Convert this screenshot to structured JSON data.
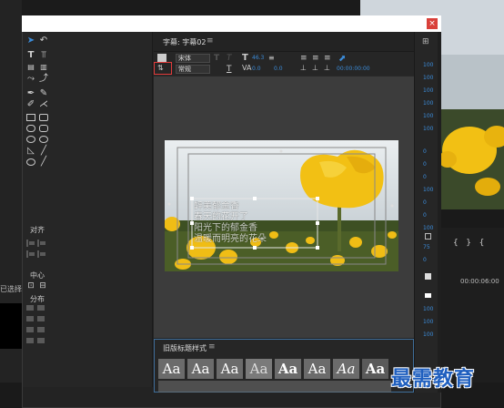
{
  "background": {
    "left_label": "已选择",
    "timecode": "00:00:06:00",
    "brackets": "{   }   {"
  },
  "dialog": {
    "close_label": "×",
    "header_title": "字幕: 字幕02",
    "header_menu": "≡",
    "toolbar": {
      "font_family": "宋体",
      "font_style": "常规",
      "font_size": "46.3",
      "tracking": "0.0",
      "leading": "0.0",
      "timecode": "00:00:00:00"
    },
    "tools": {
      "align_label": "对齐",
      "center_label": "中心",
      "distribute_label": "分布"
    },
    "canvas": {
      "caption_lines": [
        "醉美郁金香",
        "春天的花开了",
        "阳光下的郁金香",
        "温暖而明亮的花朵"
      ]
    },
    "styles": {
      "title": "旧版标题样式",
      "menu": "≡",
      "samples": [
        "Aa",
        "Aa",
        "Aa",
        "Aa",
        "Aa",
        "Aa",
        "Aa",
        "Aa"
      ]
    },
    "right_panel": {
      "menu_icon": "⊞",
      "values": [
        "100",
        "100",
        "100",
        "100",
        "100",
        "100",
        "0",
        "0",
        "0",
        "100",
        "0",
        "0",
        "100",
        "75",
        "0",
        "100",
        "100",
        "100"
      ]
    }
  },
  "watermark": "最需教育",
  "colors": {
    "accent": "#3b8bd8",
    "close": "#d9403a",
    "tulip": "#f2c014"
  }
}
